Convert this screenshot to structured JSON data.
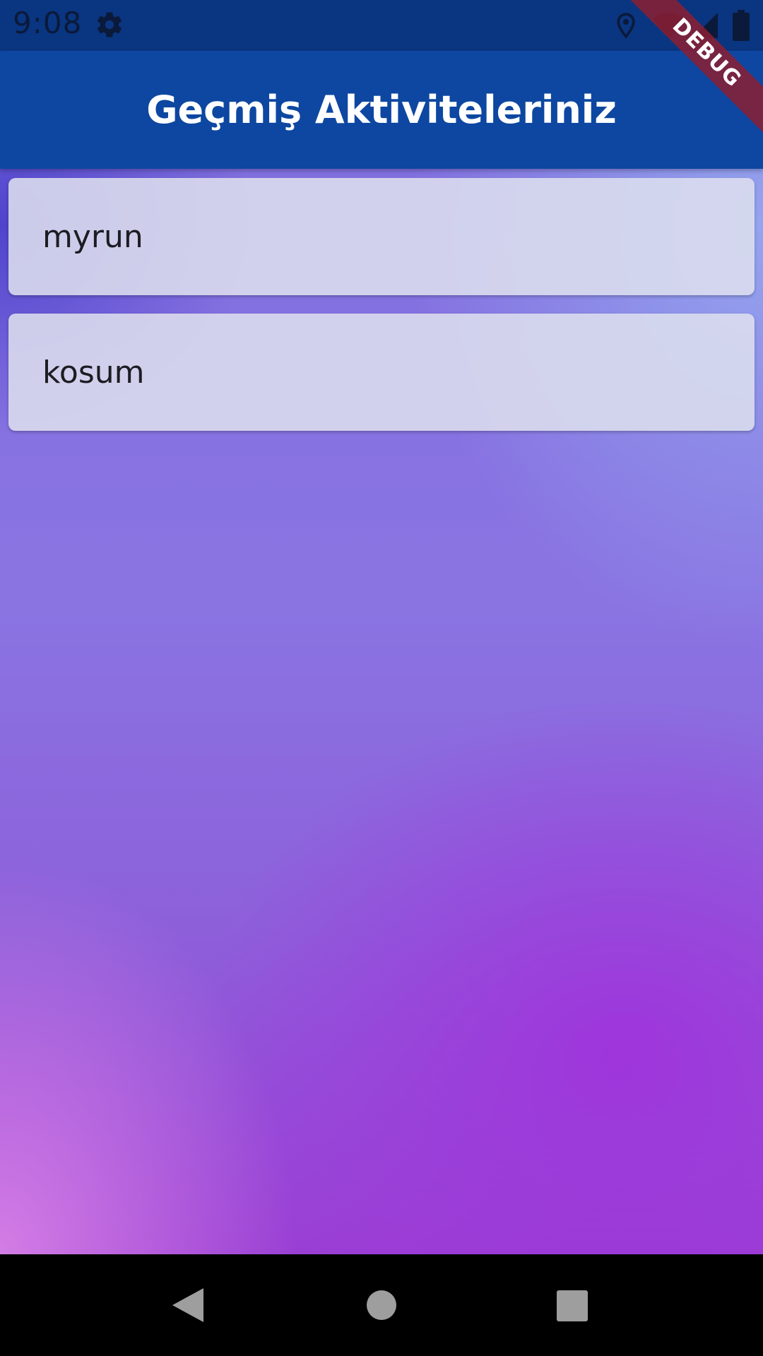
{
  "status_bar": {
    "time": "9:08",
    "icons": [
      "settings-gear-icon",
      "location-pin-icon",
      "wifi-icon",
      "cell-signal-icon",
      "battery-icon"
    ]
  },
  "app_bar": {
    "title": "Geçmiş Aktiviteleriniz"
  },
  "activities": [
    {
      "label": "myrun"
    },
    {
      "label": "kosum"
    }
  ],
  "debug_banner": {
    "label": "DEBUG"
  },
  "nav_bar": {
    "buttons": [
      "back",
      "home",
      "recents"
    ]
  },
  "colors": {
    "status_bar": "#0a3580",
    "app_bar": "#0d47a1",
    "card": "#dcdeee",
    "debug_banner": "#8c1e32"
  }
}
